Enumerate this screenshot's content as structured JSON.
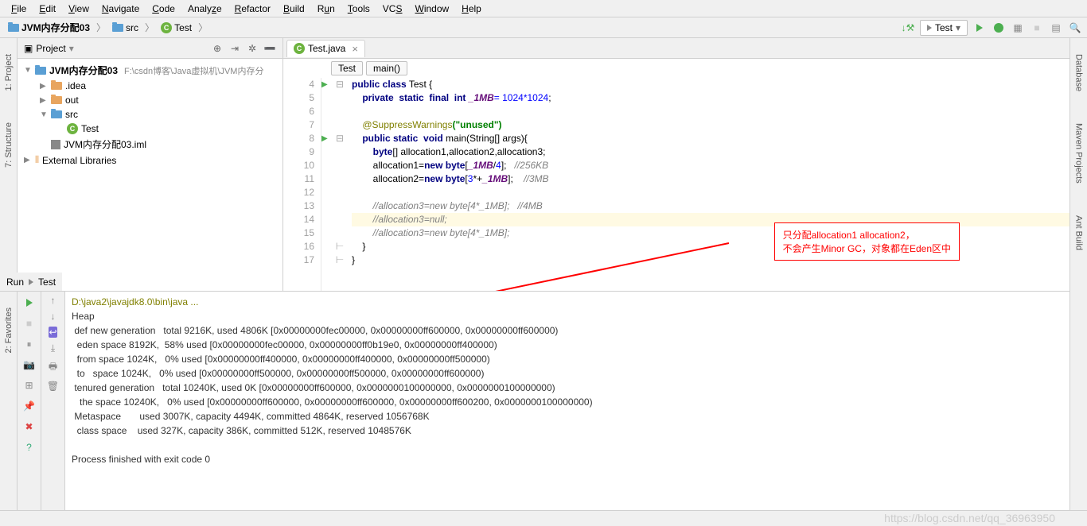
{
  "menu": [
    "File",
    "Edit",
    "View",
    "Navigate",
    "Code",
    "Analyze",
    "Refactor",
    "Build",
    "Run",
    "Tools",
    "VCS",
    "Window",
    "Help"
  ],
  "breadcrumb": {
    "project": "JVM内存分配03",
    "src": "src",
    "file": "Test"
  },
  "run_config": "Test",
  "project_panel": {
    "title": "Project",
    "root": "JVM内存分配03",
    "root_path": "F:\\csdn博客\\Java虚拟机\\JVM内存分",
    "idea": ".idea",
    "out": "out",
    "src": "src",
    "test": "Test",
    "iml": "JVM内存分配03.iml",
    "ext_lib": "External Libraries"
  },
  "editor": {
    "tab": "Test.java",
    "bc_class": "Test",
    "bc_method": "main()",
    "lines": {
      "l4": "public class Test {",
      "l5a": "private",
      "l5b": "static",
      "l5c": "final",
      "l5d": "int",
      "l5e": "_1MB",
      "l5f": "= 1024*1024;",
      "l7a": "@SuppressWarnings",
      "l7b": "(\"unused\")",
      "l8a": "public static",
      "l8b": "void",
      "l8c": " main(String[] args){",
      "l9a": "byte",
      "l9b": "[] allocation1,allocation2,allocation3;",
      "l10a": "allocation1=",
      "l10b": "new byte",
      "l10c": "[",
      "l10d": "_1MB",
      "l10e": "/4];",
      "l10f": "//256KB",
      "l11a": "allocation2=",
      "l11b": "new byte",
      "l11c": "[3*+",
      "l11d": "_1MB",
      "l11e": "];",
      "l11f": "//3MB",
      "l13": "//allocation3=new byte[4*_1MB];   //4MB",
      "l14": "//allocation3=null;",
      "l15": "//allocation3=new byte[4*_1MB];",
      "l16": "}",
      "l17": "}"
    },
    "line_nums": [
      "4",
      "5",
      "6",
      "7",
      "8",
      "9",
      "10",
      "11",
      "12",
      "13",
      "14",
      "15",
      "16",
      "17"
    ]
  },
  "annotation": {
    "line1": "只分配allocation1 allocation2，",
    "line2": "不会产生Minor GC，对象都在Eden区中"
  },
  "run": {
    "tab": "Run",
    "config": "Test",
    "cmd": "D:\\java2\\javajdk8.0\\bin\\java ...",
    "out1": "Heap",
    "out2": " def new generation   total 9216K, used 4806K [0x00000000fec00000, 0x00000000ff600000, 0x00000000ff600000)",
    "out3": "  eden space 8192K,  58% used [0x00000000fec00000, 0x00000000ff0b19e0, 0x00000000ff400000)",
    "out4": "  from space 1024K,   0% used [0x00000000ff400000, 0x00000000ff400000, 0x00000000ff500000)",
    "out5": "  to   space 1024K,   0% used [0x00000000ff500000, 0x00000000ff500000, 0x00000000ff600000)",
    "out6": " tenured generation   total 10240K, used 0K [0x00000000ff600000, 0x0000000100000000, 0x0000000100000000)",
    "out7": "   the space 10240K,   0% used [0x00000000ff600000, 0x00000000ff600000, 0x00000000ff600200, 0x0000000100000000)",
    "out8": " Metaspace       used 3007K, capacity 4494K, committed 4864K, reserved 1056768K",
    "out9": "  class space    used 327K, capacity 386K, committed 512K, reserved 1048576K",
    "out10": "",
    "out11": "Process finished with exit code 0"
  },
  "rails": {
    "project": "1: Project",
    "structure": "7: Structure",
    "favorites": "2: Favorites",
    "database": "Database",
    "maven": "Maven Projects",
    "ant": "Ant Build"
  },
  "watermark": "https://blog.csdn.net/qq_36963950"
}
